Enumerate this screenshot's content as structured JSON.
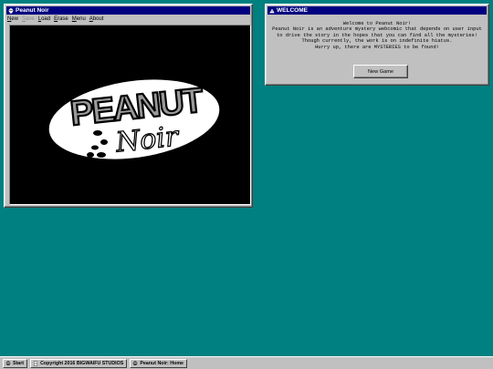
{
  "main_window": {
    "title": "Peanut Noir",
    "title_icon": "skull-icon",
    "menu": [
      {
        "label": "New",
        "accel": "N",
        "rest": "ew",
        "enabled": true
      },
      {
        "label": "Save",
        "accel": "S",
        "rest": "ave",
        "enabled": false
      },
      {
        "label": "Load",
        "accel": "L",
        "rest": "oad",
        "enabled": true
      },
      {
        "label": "Erase",
        "accel": "E",
        "rest": "rase",
        "enabled": true
      },
      {
        "label": "Menu",
        "accel": "M",
        "rest": "enu",
        "enabled": true
      },
      {
        "label": "About",
        "accel": "A",
        "rest": "bout",
        "enabled": true
      }
    ],
    "logo": {
      "word1": "PEANUT",
      "word2": "Noir"
    }
  },
  "welcome_window": {
    "title": "WELCOME",
    "title_icon": "warning-icon",
    "lines": [
      "Welcome to Peanut Noir!",
      "Peanut Noir is an adventure mystery webcomic that depends on user input",
      "to drive the story in the hopes that you can find all the mysteries!",
      "Though currently, the work is on indefinite hiatus.",
      "Hurry up, there are MYSTERIES to be found!"
    ],
    "new_game_label": "New Game"
  },
  "taskbar": {
    "start_label": "Start",
    "copyright_label": "Copyright 2016 BIGWAIFU STUDIOS",
    "task_label": "Peanut Noir: Home"
  },
  "colors": {
    "desktop": "#008080",
    "titlebar": "#000080",
    "chrome": "#c0c0c0"
  }
}
